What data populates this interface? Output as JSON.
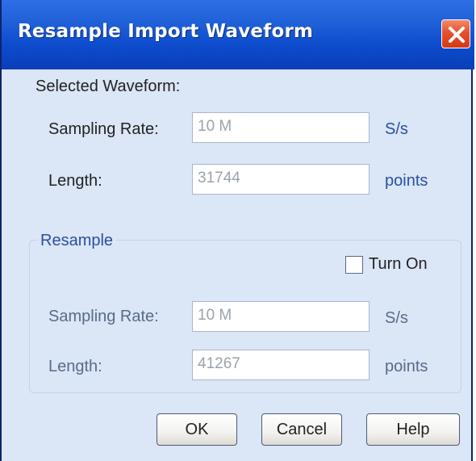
{
  "window": {
    "title": "Resample Import Waveform",
    "close_icon": "close-icon"
  },
  "selected": {
    "heading": "Selected Waveform:",
    "sampling_rate_label": "Sampling Rate:",
    "sampling_rate_value": "10 M",
    "sampling_rate_unit": "S/s",
    "length_label": "Length:",
    "length_value": "31744",
    "length_unit": "points"
  },
  "resample": {
    "group_label": "Resample",
    "turn_on_label": "Turn On",
    "turn_on_checked": false,
    "sampling_rate_label": "Sampling Rate:",
    "sampling_rate_value": "10 M",
    "sampling_rate_unit": "S/s",
    "length_label": "Length:",
    "length_value": "41267",
    "length_unit": "points"
  },
  "buttons": {
    "ok": "OK",
    "cancel": "Cancel",
    "help": "Help"
  },
  "colors": {
    "titlebar": "#0a44c1",
    "dialog_bg": "#dbe6f6",
    "close_button": "#d23a17",
    "group_label": "#2a4fa3"
  }
}
